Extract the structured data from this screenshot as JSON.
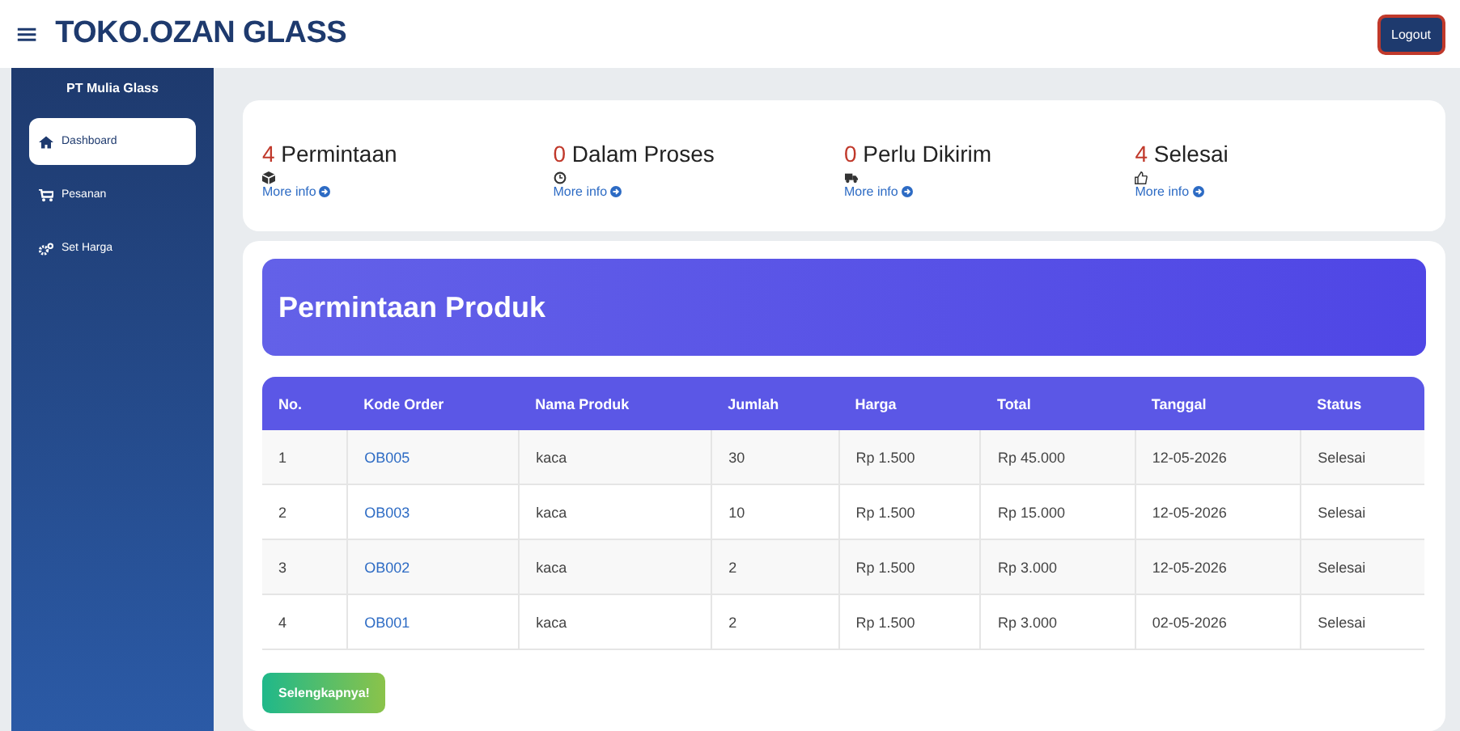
{
  "header": {
    "menu_icon": "≡",
    "brand": "TOKO.OZAN GLASS",
    "logout": "Logout"
  },
  "sidebar": {
    "company": "PT Mulia Glass",
    "items": [
      {
        "label": "Dashboard",
        "kind": "home",
        "selected": true
      },
      {
        "label": "Pesanan",
        "kind": "cart",
        "selected": false
      },
      {
        "label": "Set Harga",
        "kind": "cogs",
        "selected": false
      }
    ]
  },
  "stats": [
    {
      "count": "4",
      "label": "Permintaan",
      "kind": "box",
      "link": "More info"
    },
    {
      "count": "0",
      "label": "Dalam Proses",
      "kind": "clock",
      "link": "More info"
    },
    {
      "count": "0",
      "label": "Perlu Dikirim",
      "kind": "truck",
      "link": "More info"
    },
    {
      "count": "4",
      "label": "Selesai",
      "kind": "thumb",
      "link": "More info"
    }
  ],
  "panel": {
    "title": "Permintaan Produk",
    "button": "Selengkapnya!"
  },
  "table": {
    "columns": [
      "No.",
      "Kode Order",
      "Nama Produk",
      "Jumlah",
      "Harga",
      "Total",
      "Tanggal",
      "Status"
    ],
    "rows": [
      [
        "1",
        "OB005",
        "kaca",
        "30",
        "Rp 1.500",
        "Rp 45.000",
        "12-05-2026",
        "Selesai"
      ],
      [
        "2",
        "OB003",
        "kaca",
        "10",
        "Rp 1.500",
        "Rp 15.000",
        "12-05-2026",
        "Selesai"
      ],
      [
        "3",
        "OB002",
        "kaca",
        "2",
        "Rp 1.500",
        "Rp 3.000",
        "12-05-2026",
        "Selesai"
      ],
      [
        "4",
        "OB001",
        "kaca",
        "2",
        "Rp 1.500",
        "Rp 3.000",
        "02-05-2026",
        "Selesai"
      ]
    ]
  }
}
